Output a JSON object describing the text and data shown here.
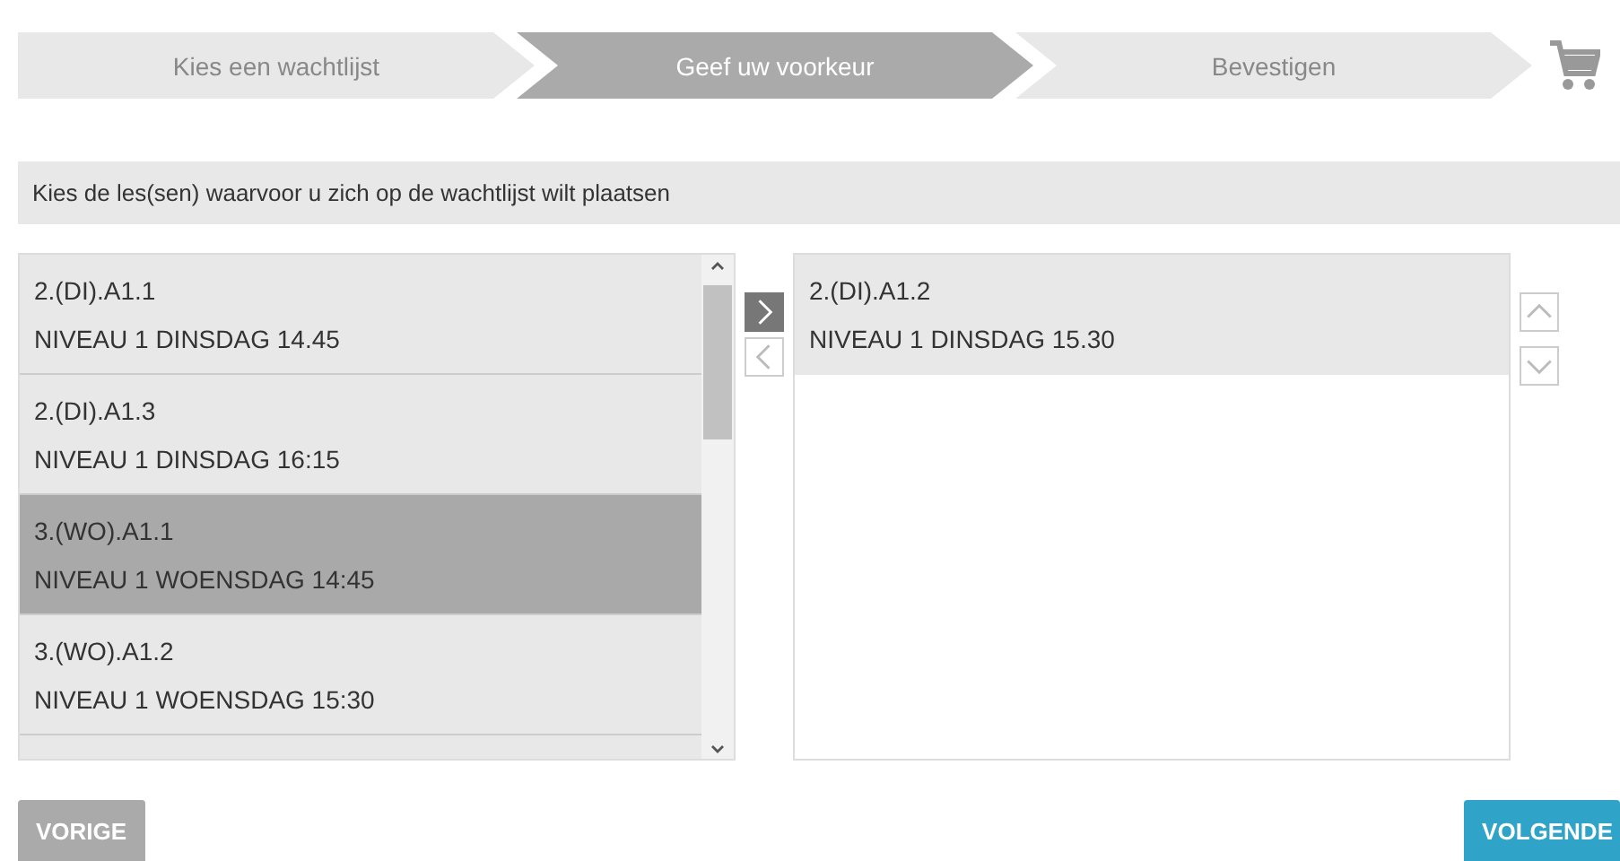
{
  "steps": [
    {
      "label": "Kies een wachtlijst",
      "selected": false
    },
    {
      "label": "Geef uw voorkeur",
      "selected": true
    },
    {
      "label": "Bevestigen",
      "selected": false
    }
  ],
  "instruction": "Kies de les(sen) waarvoor u zich op de wachtlijst wilt plaatsen",
  "available": [
    {
      "code": "2.(DI).A1.1",
      "title": "NIVEAU 1 DINSDAG 14.45",
      "selected": false
    },
    {
      "code": "2.(DI).A1.3",
      "title": "NIVEAU 1 DINSDAG 16:15",
      "selected": false
    },
    {
      "code": "3.(WO).A1.1",
      "title": "NIVEAU 1 WOENSDAG 14:45",
      "selected": true
    },
    {
      "code": "3.(WO).A1.2",
      "title": "NIVEAU 1 WOENSDAG 15:30",
      "selected": false
    }
  ],
  "move_buttons": [
    {
      "kind": "add",
      "disabled": false
    },
    {
      "kind": "remove",
      "disabled": true
    }
  ],
  "chosen": [
    {
      "code": "2.(DI).A1.2",
      "title": "NIVEAU 1 DINSDAG 15.30",
      "selected": false
    }
  ],
  "order_buttons": [
    {
      "kind": "up",
      "disabled": true
    },
    {
      "kind": "down",
      "disabled": true
    }
  ],
  "back_button": "VORIGE",
  "next_button": "VOLGENDE"
}
